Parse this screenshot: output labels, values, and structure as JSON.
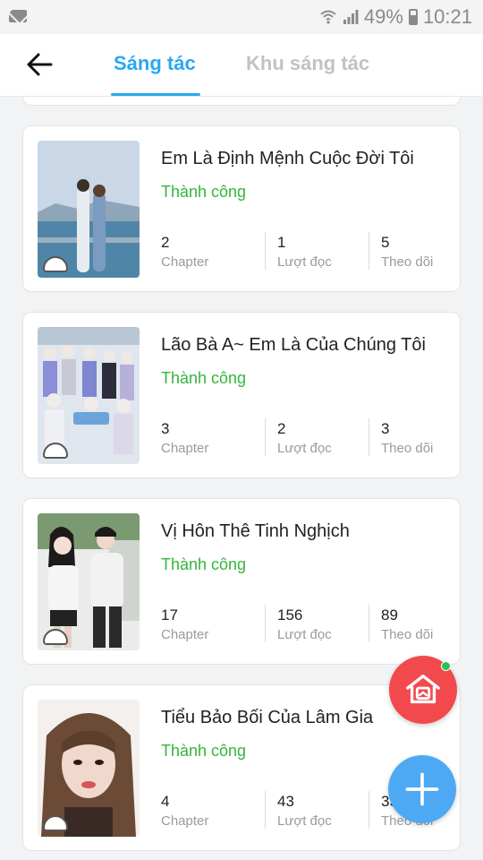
{
  "status_bar": {
    "battery": "49%",
    "time": "10:21"
  },
  "header": {
    "tabs": [
      {
        "label": "Sáng tác",
        "active": true
      },
      {
        "label": "Khu sáng tác",
        "active": false
      }
    ]
  },
  "stories": [
    {
      "title": "Em Là Định Mệnh Cuộc Đời Tôi",
      "status": "Thành công",
      "stats": [
        {
          "value": "2",
          "label": "Chapter"
        },
        {
          "value": "1",
          "label": "Lượt đọc"
        },
        {
          "value": "5",
          "label": "Theo dõi"
        }
      ]
    },
    {
      "title": "Lão Bà A~ Em Là Của Chúng Tôi",
      "status": "Thành công",
      "stats": [
        {
          "value": "3",
          "label": "Chapter"
        },
        {
          "value": "2",
          "label": "Lượt đọc"
        },
        {
          "value": "3",
          "label": "Theo dõi"
        }
      ]
    },
    {
      "title": "Vị Hôn Thê Tinh Nghịch",
      "status": "Thành công",
      "stats": [
        {
          "value": "17",
          "label": "Chapter"
        },
        {
          "value": "156",
          "label": "Lượt đọc"
        },
        {
          "value": "89",
          "label": "Theo dõi"
        }
      ]
    },
    {
      "title": "Tiểu Bảo Bối Của Lâm Gia",
      "status": "Thành công",
      "stats": [
        {
          "value": "4",
          "label": "Chapter"
        },
        {
          "value": "43",
          "label": "Lượt đọc"
        },
        {
          "value": "35",
          "label": "Theo dõi"
        }
      ]
    }
  ],
  "colors": {
    "accent": "#2aa8ef",
    "success": "#35b53b",
    "fab_red": "#f2494d",
    "fab_blue": "#4ea9f5"
  },
  "icons": {
    "back": "arrow-left-icon",
    "home_fab": "house-icon",
    "add_fab": "plus-icon"
  }
}
